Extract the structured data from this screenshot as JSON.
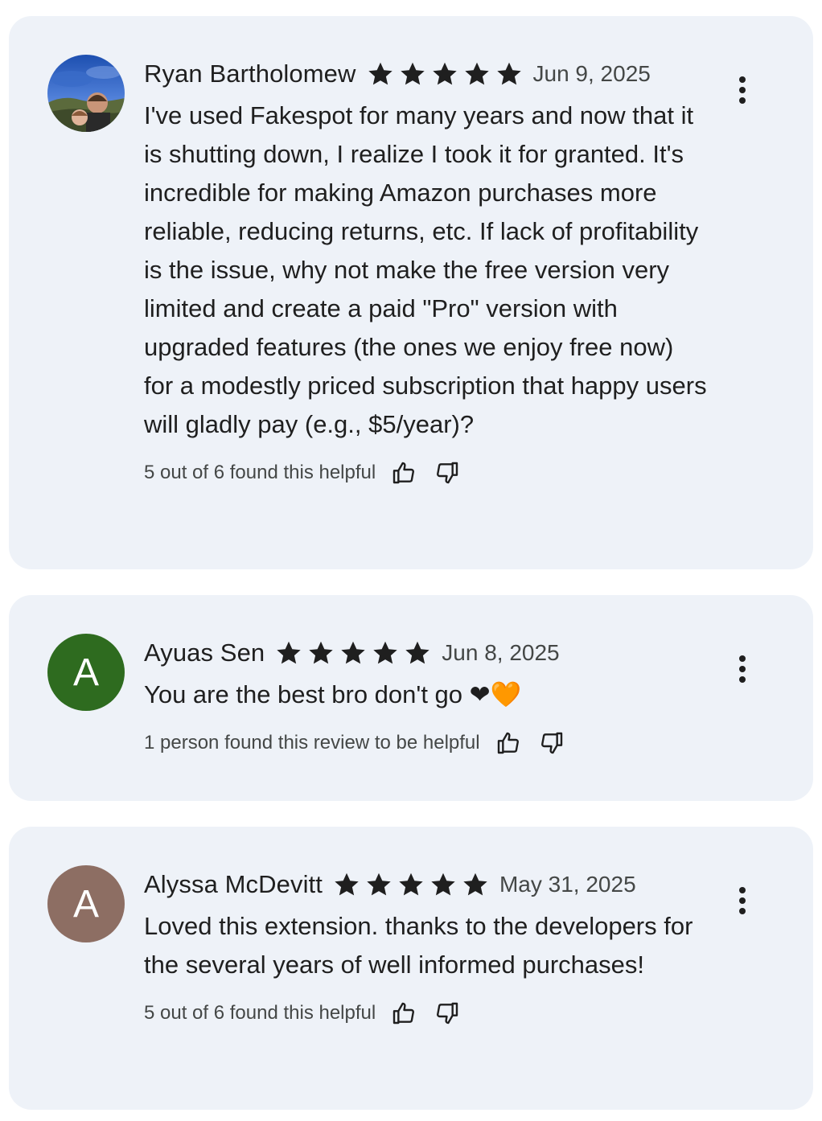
{
  "colors": {
    "card_background": "#eef2f8",
    "star": "#1f1f1f",
    "secondary_text": "#444746",
    "avatar_green": "#2e6b1f",
    "avatar_rose": "#8d6e63"
  },
  "icons": {
    "star": "star-icon",
    "thumbs_up": "thumbs-up-icon",
    "thumbs_down": "thumbs-down-icon",
    "more": "more-vert-icon"
  },
  "reviews": [
    {
      "name": "Ryan Bartholomew",
      "avatar_type": "photo",
      "rating": 5,
      "date": "Jun 9, 2025",
      "text": "I've used Fakespot for many years and now that it is shutting down, I realize I took it for granted. It's incredible for making Amazon purchases more reliable, reducing returns, etc. If lack of profitability is the issue, why not make the free version very limited and create a paid \"Pro\" version with upgraded features (the ones we enjoy free now) for a modestly priced subscription that happy users will gladly pay (e.g., $5/year)?",
      "helpful": "5 out of 6 found this helpful"
    },
    {
      "name": "Ayuas Sen",
      "avatar_type": "initial",
      "avatar_initial": "A",
      "avatar_color": "#2e6b1f",
      "rating": 5,
      "date": "Jun 8, 2025",
      "text": "You are the best bro don't go ❤🧡",
      "helpful": "1 person found this review to be helpful"
    },
    {
      "name": "Alyssa McDevitt",
      "avatar_type": "initial",
      "avatar_initial": "A",
      "avatar_color": "#8d6e63",
      "rating": 5,
      "date": "May 31, 2025",
      "text": "Loved this extension. thanks to the developers for the several years of well informed purchases!",
      "helpful": "5 out of 6 found this helpful"
    }
  ]
}
